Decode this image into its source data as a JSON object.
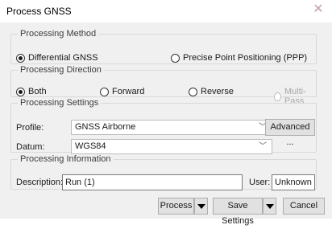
{
  "window": {
    "title": "Process GNSS"
  },
  "method": {
    "legend": "Processing Method",
    "options": [
      {
        "label": "Differential GNSS",
        "selected": true
      },
      {
        "label": "Precise Point Positioning (PPP)",
        "selected": false
      }
    ]
  },
  "direction": {
    "legend": "Processing Direction",
    "options": [
      {
        "label": "Both",
        "selected": true
      },
      {
        "label": "Forward",
        "selected": false
      },
      {
        "label": "Reverse",
        "selected": false
      },
      {
        "label": "Multi-Pass",
        "selected": false,
        "disabled": true
      }
    ]
  },
  "settings": {
    "legend": "Processing Settings",
    "profile_label": "Profile:",
    "profile_value": "GNSS Airborne",
    "advanced_label": "Advanced ...",
    "datum_label": "Datum:",
    "datum_value": "WGS84"
  },
  "info": {
    "legend": "Processing Information",
    "description_label": "Description:",
    "description_value": "Run (1)",
    "user_label": "User:",
    "user_value": "Unknown"
  },
  "footer": {
    "process_label": "Process",
    "save_settings_label": "Save Settings",
    "cancel_label": "Cancel"
  },
  "icons": {
    "close": "close-icon",
    "dropdown": "chevron-down-icon",
    "split": "triangle-down-icon"
  }
}
